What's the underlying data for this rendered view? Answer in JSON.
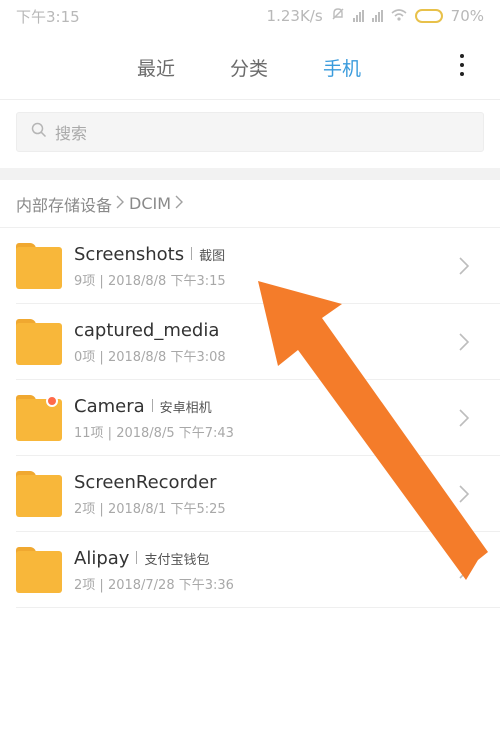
{
  "status_bar": {
    "time": "下午3:15",
    "network_speed": "1.23K/s",
    "battery_percent": "70%",
    "battery_level": 0.7
  },
  "tabs": [
    {
      "label": "最近",
      "active": false
    },
    {
      "label": "分类",
      "active": false
    },
    {
      "label": "手机",
      "active": true
    }
  ],
  "search": {
    "placeholder": "搜索"
  },
  "breadcrumb": [
    "内部存储设备",
    "DCIM"
  ],
  "folders": [
    {
      "name": "Screenshots",
      "alias": "截图",
      "count": "9项",
      "date": "2018/8/8 下午3:15",
      "badge": false
    },
    {
      "name": "captured_media",
      "alias": "",
      "count": "0项",
      "date": "2018/8/8 下午3:08",
      "badge": false
    },
    {
      "name": "Camera",
      "alias": "安卓相机",
      "count": "11项",
      "date": "2018/8/5 下午7:43",
      "badge": true
    },
    {
      "name": "ScreenRecorder",
      "alias": "",
      "count": "2项",
      "date": "2018/8/1 下午5:25",
      "badge": false
    },
    {
      "name": "Alipay",
      "alias": "支付宝钱包",
      "count": "2项",
      "date": "2018/7/28 下午3:36",
      "badge": false
    }
  ],
  "colors": {
    "accent": "#3a9bdc",
    "folder": "#f8b73a",
    "annotation_arrow": "#f47c2a"
  },
  "icons": {
    "more": "more-vertical-icon",
    "search": "search-icon",
    "chevron": "chevron-right-icon",
    "folder": "folder-icon"
  }
}
